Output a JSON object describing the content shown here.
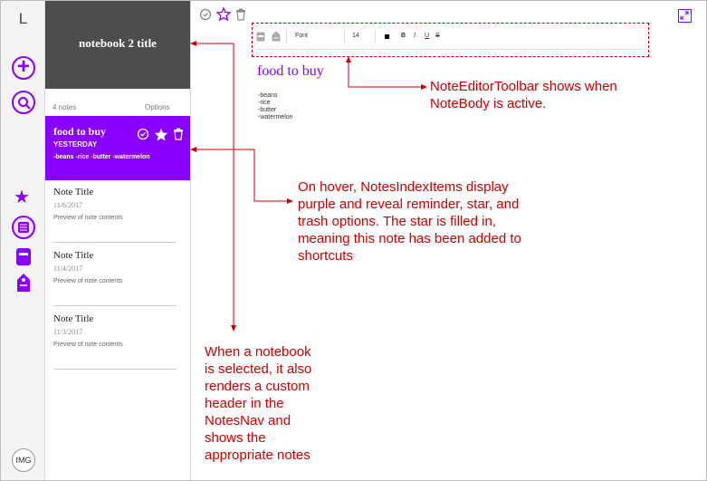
{
  "rail": {
    "logo": "L",
    "avatar": "IMG"
  },
  "notebook": {
    "title": "notebook 2 title",
    "count": "4 notes",
    "options": "Options"
  },
  "notes": [
    {
      "title": "food to buy",
      "date": "YESTERDAY",
      "preview": "-beans -rice -butter -watermelon"
    },
    {
      "title": "Note Title",
      "date": "11/6/2017",
      "preview": "Preview of note contents"
    },
    {
      "title": "Note Title",
      "date": "11/4/2017",
      "preview": "Preview of note contents"
    },
    {
      "title": "Note Title",
      "date": "11/3/2017",
      "preview": "Preview of note contents"
    }
  ],
  "toolbar": {
    "font": "Font",
    "size": "14",
    "bold": "B",
    "italic": "I",
    "underline": "U",
    "strike": "S"
  },
  "note_body": {
    "title": "food to buy",
    "lines": [
      "-beans",
      "-rice",
      "-butter",
      "-watermelon"
    ]
  },
  "annotations": {
    "toolbar": [
      "NoteEditorToolbar shows when",
      "NoteBody is active."
    ],
    "hover": [
      "On hover, NotesIndexItems display",
      "purple and reveal reminder, star, and",
      "trash options. The star is filled in,",
      "meaning this note has been added to",
      "shortcuts"
    ],
    "notebook": [
      "When a notebook",
      "is selected, it also",
      "renders a custom",
      "header in the",
      "NotesNav and",
      "shows the",
      "appropriate notes"
    ]
  },
  "colors": {
    "accent": "#8a00ff",
    "annotation": "#cc0000",
    "header_bg": "#4d4d4d"
  }
}
